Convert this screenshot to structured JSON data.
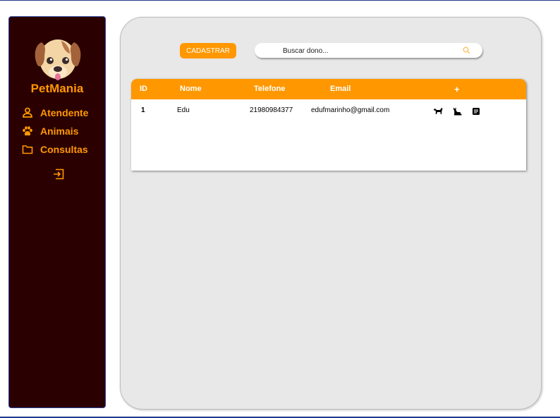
{
  "brand": {
    "name": "PetMania",
    "logo_icon": "dog-face-icon"
  },
  "sidebar": {
    "items": [
      {
        "label": "Atendente",
        "icon": "person-icon"
      },
      {
        "label": "Animais",
        "icon": "paw-icon"
      },
      {
        "label": "Consultas",
        "icon": "folder-icon"
      }
    ],
    "logout_icon": "logout-icon"
  },
  "toolbar": {
    "cadastrar_label": "CADASTRAR",
    "search_placeholder": "Buscar dono...",
    "search_value": ""
  },
  "table": {
    "columns": [
      "ID",
      "Nome",
      "Telefone",
      "Email",
      "+"
    ],
    "rows": [
      {
        "id": "1",
        "nome": "Edu",
        "telefone": "21980984377",
        "email": "edufmarinho@gmail.com",
        "actions": [
          "dog-icon",
          "cat-icon",
          "notes-icon"
        ]
      }
    ]
  },
  "colors": {
    "accent": "#ff9800",
    "sidebar_bg": "#2b0000",
    "panel_bg": "#e8e8e8"
  }
}
